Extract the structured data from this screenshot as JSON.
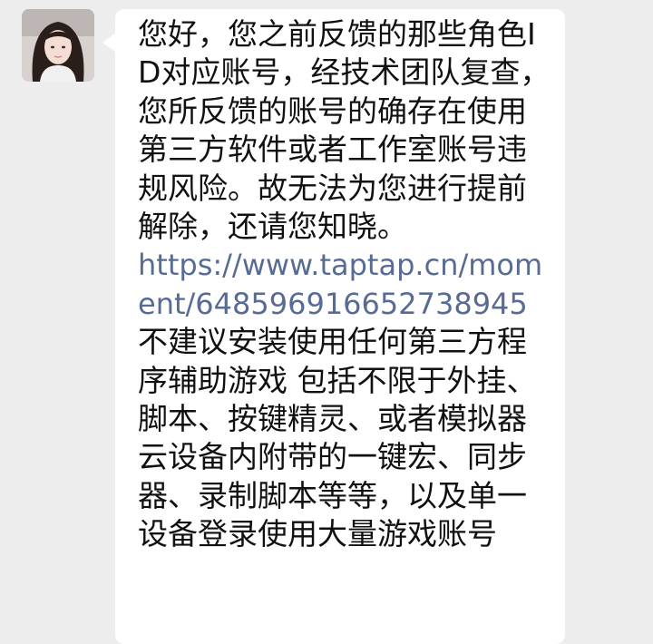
{
  "message": {
    "paragraph_1": "您好，您之前反馈的那些角色ID对应账号，经技术团队复查，您所反馈的账号的确存在使用第三方软件或者工作室账号违规风险。故无法为您进行提前解除，还请您知晓。",
    "link": "https://www.taptap.cn/moment/648596916652738945",
    "paragraph_2": "不建议安装使用任何第三方程序辅助游戏 包括不限于外挂、脚本、按键精灵、或者模拟器云设备内附带的一键宏、同步器、录制脚本等等，以及单一设备登录使用大量游戏账号"
  },
  "colors": {
    "background": "#ededed",
    "bubble": "#ffffff",
    "text": "#111111",
    "link": "#576b95"
  }
}
